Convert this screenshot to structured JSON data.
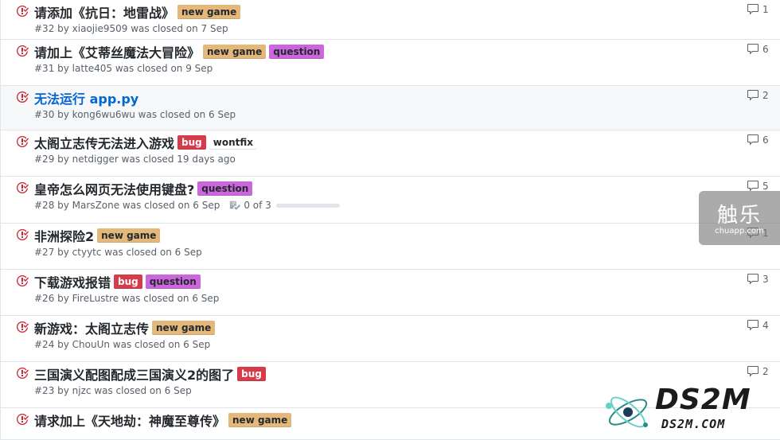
{
  "issues": [
    {
      "title": "请添加《抗日：地雷战》",
      "labels": [
        {
          "text": "new game",
          "bg": "#e4b87a",
          "fg": "#24292e"
        }
      ],
      "meta": "#32 by xiaojie9509 was closed on 7 Sep",
      "comments": "1",
      "link": false
    },
    {
      "title": "请加上《艾蒂丝魔法大冒险》",
      "labels": [
        {
          "text": "new game",
          "bg": "#e4b87a",
          "fg": "#24292e"
        },
        {
          "text": "question",
          "bg": "#cc66dd",
          "fg": "#24292e"
        }
      ],
      "meta": "#31 by latte405 was closed on 9 Sep",
      "comments": "6",
      "link": false
    },
    {
      "title": "无法运行 app.py",
      "labels": [],
      "meta": "#30 by kong6wu6wu was closed on 6 Sep",
      "comments": "2",
      "link": true
    },
    {
      "title": "太阁立志传无法进入游戏",
      "labels": [
        {
          "text": "bug",
          "bg": "#d73a4a",
          "fg": "#ffffff"
        },
        {
          "text": "wontfix",
          "bg": "#ffffff",
          "fg": "#24292e"
        }
      ],
      "meta": "#29 by netdigger was closed 19 days ago",
      "comments": "6",
      "link": false
    },
    {
      "title": "皇帝怎么网页无法使用键盘?",
      "labels": [
        {
          "text": "question",
          "bg": "#cc66dd",
          "fg": "#24292e"
        }
      ],
      "meta": "#28 by MarsZone was closed on 6 Sep",
      "progress": "0 of 3",
      "comments": "5",
      "link": false
    },
    {
      "title": "非洲探险2",
      "labels": [
        {
          "text": "new game",
          "bg": "#e4b87a",
          "fg": "#24292e"
        }
      ],
      "meta": "#27 by ctyytc was closed on 6 Sep",
      "comments": "1",
      "link": false
    },
    {
      "title": "下载游戏报错",
      "labels": [
        {
          "text": "bug",
          "bg": "#d73a4a",
          "fg": "#ffffff"
        },
        {
          "text": "question",
          "bg": "#cc66dd",
          "fg": "#24292e"
        }
      ],
      "meta": "#26 by FireLustre was closed on 6 Sep",
      "comments": "3",
      "link": false
    },
    {
      "title": "新游戏：太阁立志传",
      "labels": [
        {
          "text": "new game",
          "bg": "#e4b87a",
          "fg": "#24292e"
        }
      ],
      "meta": "#24 by ChouUn was closed on 6 Sep",
      "comments": "4",
      "link": false
    },
    {
      "title": "三国演义配图配成三国演义2的图了",
      "labels": [
        {
          "text": "bug",
          "bg": "#d73a4a",
          "fg": "#ffffff"
        }
      ],
      "meta": "#23 by njzc was closed on 6 Sep",
      "comments": "2",
      "link": false
    },
    {
      "title": "请求加上《天地劫：神魔至尊传》",
      "labels": [
        {
          "text": "new game",
          "bg": "#e4b87a",
          "fg": "#24292e"
        }
      ],
      "meta": "",
      "comments": "",
      "link": false
    }
  ],
  "watermarks": {
    "chuapp_big": "触乐",
    "chuapp_small": "chuapp.com",
    "ds2m_big": "DS2M",
    "ds2m_small": "DS2M.COM"
  },
  "colors": {
    "closed_icon": "#cb2431",
    "link": "#0366d6",
    "meta": "#586069"
  }
}
